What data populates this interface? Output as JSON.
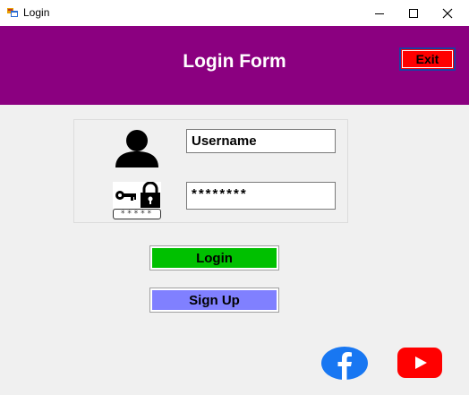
{
  "window": {
    "title": "Login",
    "icon": "app-window-icon",
    "controls": [
      "minimize-icon",
      "maximize-icon",
      "close-icon"
    ]
  },
  "header": {
    "title": "Login Form",
    "exit_label": "Exit",
    "colors": {
      "band": "#8b0080",
      "exit_button": "#ff0000"
    }
  },
  "form": {
    "username_value": "Username",
    "password_value": "********",
    "password_badge": "*****",
    "icons": [
      "user-icon",
      "key-lock-icon"
    ]
  },
  "actions": {
    "login_label": "Login",
    "signup_label": "Sign Up",
    "colors": {
      "login": "#00c000",
      "signup": "#8080ff"
    }
  },
  "social": {
    "icons": [
      "facebook-icon",
      "youtube-icon"
    ]
  }
}
